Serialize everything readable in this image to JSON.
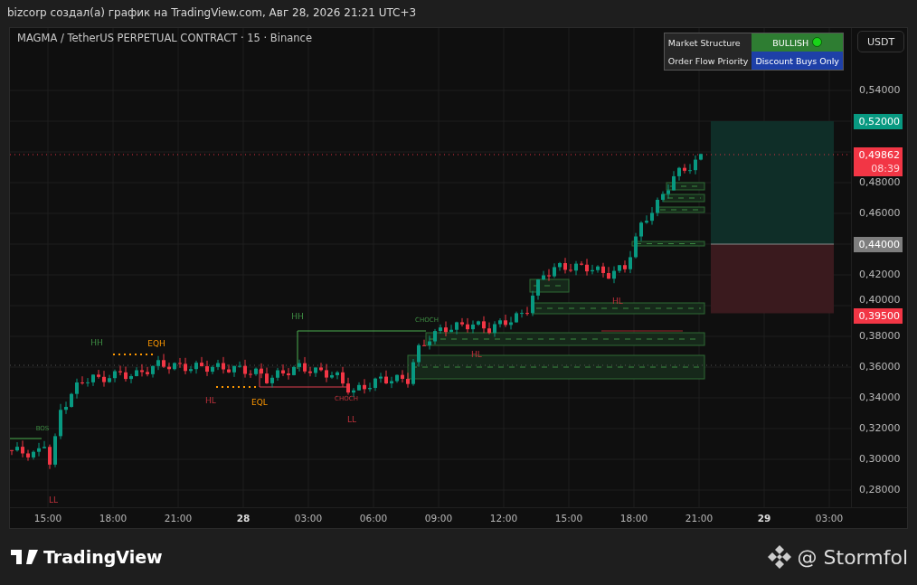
{
  "header": {
    "text": "bizcorp создал(а) график на TradingView.com, Авг 28, 2026 21:21 UTC+3"
  },
  "chart": {
    "symbol": "MAGMA / TetherUS PERPETUAL CONTRACT · 15 · Binance",
    "currency_button": "USDT",
    "info_table": [
      {
        "label": "Market Structure",
        "value": "BULLISH",
        "kind": "status",
        "color": "#2e7d32"
      },
      {
        "label": "Order Flow Priority",
        "value": "Discount Buys Only",
        "kind": "plain",
        "color": "#1e40a8"
      }
    ],
    "price_axis": [
      "0,54000",
      "0,48000",
      "0,46000",
      "0,42000",
      "0,40000",
      "0,38000",
      "0,36000",
      "0,34000",
      "0,32000",
      "0,30000",
      "0,28000"
    ],
    "price_tags": [
      {
        "value": "0,52000",
        "kind": "target"
      },
      {
        "value": "0,49862",
        "countdown": "08:39",
        "kind": "last"
      },
      {
        "value": "0,44000",
        "kind": "entry"
      },
      {
        "value": "0,39500",
        "kind": "stop"
      }
    ],
    "time_axis": [
      {
        "label": "15:00",
        "bold": false
      },
      {
        "label": "18:00",
        "bold": false
      },
      {
        "label": "21:00",
        "bold": false
      },
      {
        "label": "28",
        "bold": true
      },
      {
        "label": "03:00",
        "bold": false
      },
      {
        "label": "06:00",
        "bold": false
      },
      {
        "label": "09:00",
        "bold": false
      },
      {
        "label": "12:00",
        "bold": false
      },
      {
        "label": "15:00",
        "bold": false
      },
      {
        "label": "18:00",
        "bold": false
      },
      {
        "label": "21:00",
        "bold": false
      },
      {
        "label": "29",
        "bold": true
      },
      {
        "label": "03:00",
        "bold": false
      }
    ],
    "markers": [
      {
        "text": "HH",
        "kind": "bullish"
      },
      {
        "text": "EQH",
        "kind": "equal"
      },
      {
        "text": "HL",
        "kind": "bearish"
      },
      {
        "text": "EQL",
        "kind": "equal"
      },
      {
        "text": "HH",
        "kind": "bullish"
      },
      {
        "text": "CHOCH",
        "kind": "bearish"
      },
      {
        "text": "LL",
        "kind": "bearish"
      },
      {
        "text": "BOS",
        "kind": "bullish"
      },
      {
        "text": "LL",
        "kind": "bearish"
      },
      {
        "text": "CHOCH",
        "kind": "bullish"
      },
      {
        "text": "HL",
        "kind": "bearish"
      },
      {
        "text": "HL",
        "kind": "bearish"
      }
    ]
  },
  "footer": {
    "brand": "TradingView",
    "author": "@ Stormfol"
  }
}
